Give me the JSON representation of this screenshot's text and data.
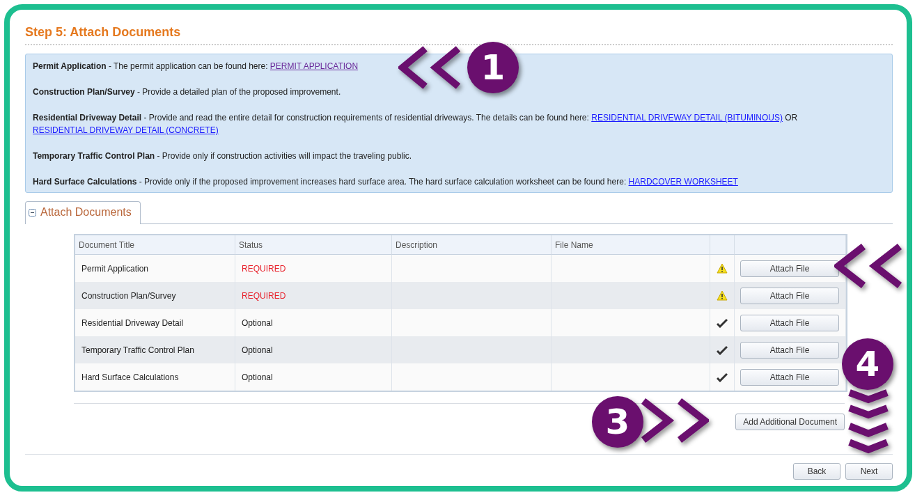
{
  "title": "Step 5: Attach Documents",
  "info": [
    {
      "heading": "Permit Application",
      "parts": [
        {
          "kind": "text",
          "text": " - The permit application can be found here: "
        },
        {
          "kind": "link",
          "text": "PERMIT APPLICATION",
          "visited": true
        }
      ]
    },
    {
      "heading": "Construction Plan/Survey",
      "parts": [
        {
          "kind": "text",
          "text": " - Provide a detailed plan of the proposed improvement."
        }
      ]
    },
    {
      "heading": "Residential Driveway Detail",
      "parts": [
        {
          "kind": "text",
          "text": " - Provide and read the entire detail for construction requirements of residential driveways. The details can be found here: "
        },
        {
          "kind": "link",
          "text": "RESIDENTIAL DRIVEWAY DETAIL (BITUMINOUS)",
          "visited": false
        },
        {
          "kind": "text",
          "text": " OR "
        },
        {
          "kind": "link",
          "text": "RESIDENTIAL DRIVEWAY DETAIL (CONCRETE)",
          "visited": false
        }
      ]
    },
    {
      "heading": "Temporary Traffic Control Plan",
      "parts": [
        {
          "kind": "text",
          "text": " - Provide only if construction activities will impact the traveling public."
        }
      ]
    },
    {
      "heading": "Hard Surface Calculations",
      "parts": [
        {
          "kind": "text",
          "text": " - Provide only if the proposed improvement increases hard surface area. The hard surface calculation worksheet can be found here: "
        },
        {
          "kind": "link",
          "text": "HARDCOVER WORKSHEET",
          "visited": false
        }
      ]
    }
  ],
  "section": {
    "label": "Attach Documents",
    "expanded": true
  },
  "table": {
    "columns": [
      "Document Title",
      "Status",
      "Description",
      "File Name"
    ],
    "rows": [
      {
        "title": "Permit Application",
        "status": "REQUIRED",
        "required": true,
        "button": "Attach File"
      },
      {
        "title": "Construction Plan/Survey",
        "status": "REQUIRED",
        "required": true,
        "button": "Attach File"
      },
      {
        "title": "Residential Driveway Detail",
        "status": "Optional",
        "required": false,
        "button": "Attach File"
      },
      {
        "title": "Temporary Traffic Control Plan",
        "status": "Optional",
        "required": false,
        "button": "Attach File"
      },
      {
        "title": "Hard Surface Calculations",
        "status": "Optional",
        "required": false,
        "button": "Attach File"
      }
    ]
  },
  "add_button": "Add Additional Document",
  "nav_buttons": [
    "Back",
    "Next"
  ],
  "callouts": [
    "1",
    "3",
    "4"
  ]
}
